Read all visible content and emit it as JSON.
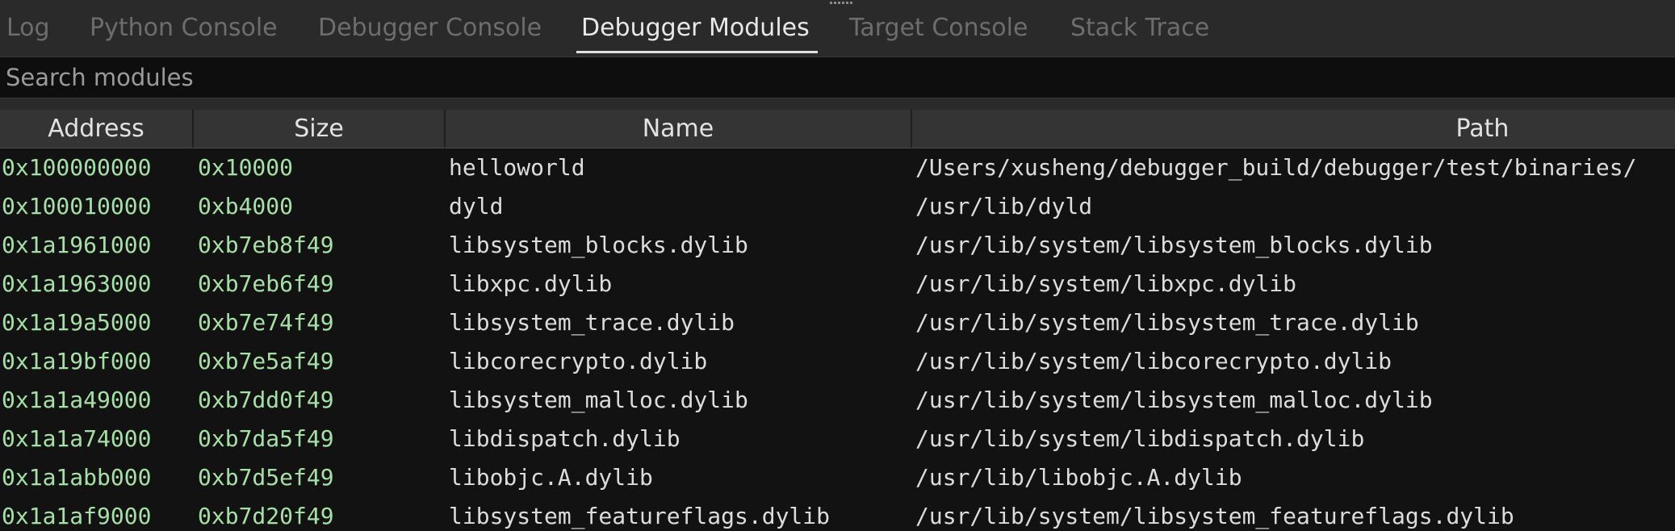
{
  "tabs": [
    {
      "label": "Log",
      "active": false
    },
    {
      "label": "Python Console",
      "active": false
    },
    {
      "label": "Debugger Console",
      "active": false
    },
    {
      "label": "Debugger Modules",
      "active": true
    },
    {
      "label": "Target Console",
      "active": false
    },
    {
      "label": "Stack Trace",
      "active": false
    }
  ],
  "search": {
    "placeholder": "Search modules",
    "value": ""
  },
  "table": {
    "columns": [
      "Address",
      "Size",
      "Name",
      "Path"
    ],
    "rows": [
      {
        "address": "0x100000000",
        "size": "0x10000",
        "name": "helloworld",
        "path": "/Users/xusheng/debugger_build/debugger/test/binaries/"
      },
      {
        "address": "0x100010000",
        "size": "0xb4000",
        "name": "dyld",
        "path": "/usr/lib/dyld"
      },
      {
        "address": "0x1a1961000",
        "size": "0xb7eb8f49",
        "name": "libsystem_blocks.dylib",
        "path": "/usr/lib/system/libsystem_blocks.dylib"
      },
      {
        "address": "0x1a1963000",
        "size": "0xb7eb6f49",
        "name": "libxpc.dylib",
        "path": "/usr/lib/system/libxpc.dylib"
      },
      {
        "address": "0x1a19a5000",
        "size": "0xb7e74f49",
        "name": "libsystem_trace.dylib",
        "path": "/usr/lib/system/libsystem_trace.dylib"
      },
      {
        "address": "0x1a19bf000",
        "size": "0xb7e5af49",
        "name": "libcorecrypto.dylib",
        "path": "/usr/lib/system/libcorecrypto.dylib"
      },
      {
        "address": "0x1a1a49000",
        "size": "0xb7dd0f49",
        "name": "libsystem_malloc.dylib",
        "path": "/usr/lib/system/libsystem_malloc.dylib"
      },
      {
        "address": "0x1a1a74000",
        "size": "0xb7da5f49",
        "name": "libdispatch.dylib",
        "path": "/usr/lib/system/libdispatch.dylib"
      },
      {
        "address": "0x1a1abb000",
        "size": "0xb7d5ef49",
        "name": "libobjc.A.dylib",
        "path": "/usr/lib/libobjc.A.dylib"
      },
      {
        "address": "0x1a1af9000",
        "size": "0xb7d20f49",
        "name": "libsystem_featureflags.dylib",
        "path": "/usr/lib/system/libsystem_featureflags.dylib"
      }
    ]
  },
  "colors": {
    "address_text": "#a5e0a5",
    "cell_text": "#dcdcdc",
    "active_tab": "#e8e8e8",
    "inactive_tab": "#6d6d6d"
  }
}
